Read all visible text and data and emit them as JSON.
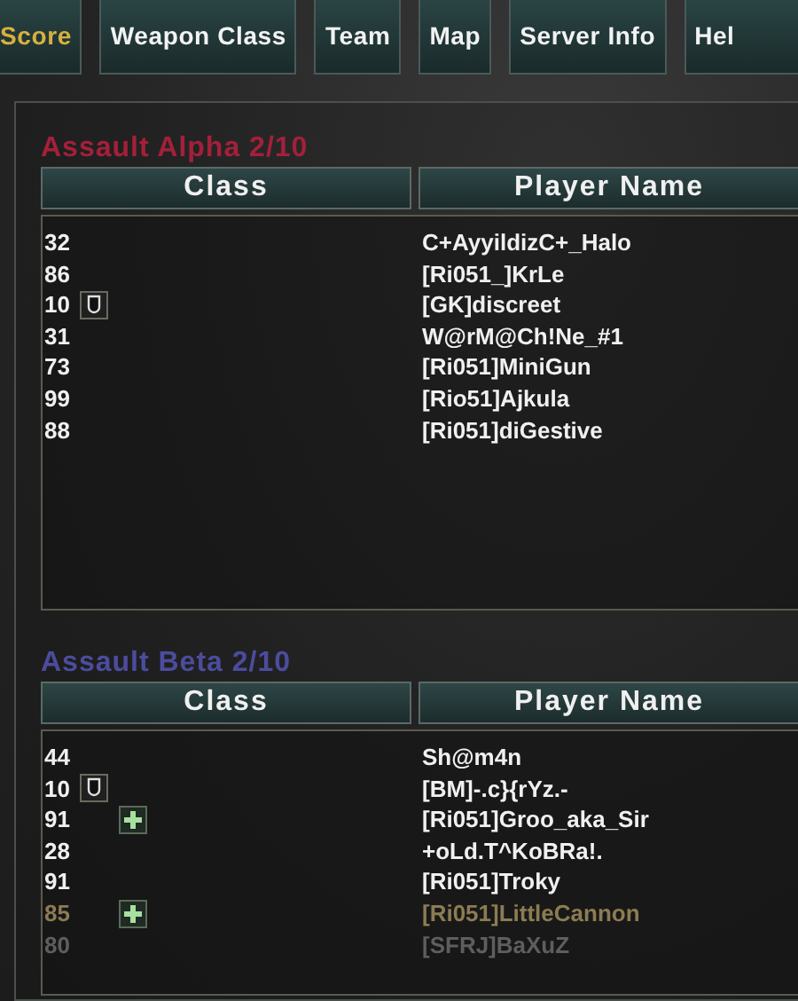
{
  "tabs": [
    {
      "label": "Score",
      "selected": true
    },
    {
      "label": "Weapon Class",
      "selected": false
    },
    {
      "label": "Team",
      "selected": false
    },
    {
      "label": "Map",
      "selected": false
    },
    {
      "label": "Server Info",
      "selected": false
    },
    {
      "label": "Hel",
      "selected": false
    }
  ],
  "teams": [
    {
      "title": "Assault Alpha 2/10",
      "color": "#a3203a",
      "columns": [
        "Class",
        "Player Name"
      ],
      "rows": [
        {
          "class": "32",
          "player": "C+AyyildizC+_Halo",
          "kind": "normal"
        },
        {
          "class": "86",
          "player": "[Ri051_]KrLe",
          "kind": "normal"
        },
        {
          "class": "10",
          "badge": {
            "kind": "shield"
          },
          "player": "[GK]discreet",
          "kind": "normal"
        },
        {
          "class": "31",
          "player": "W@rM@Ch!Ne_#1",
          "kind": "normal"
        },
        {
          "class": "73",
          "player": "[Ri051]MiniGun",
          "kind": "normal"
        },
        {
          "class": "99",
          "player": "[Rio51]Ajkula",
          "kind": "normal"
        },
        {
          "class": "88",
          "player": "[Ri051]diGestive",
          "kind": "normal"
        }
      ]
    },
    {
      "title": "Assault Beta 2/10",
      "color": "#4c4c9e",
      "columns": [
        "Class",
        "Player Name"
      ],
      "rows": [
        {
          "class": "44",
          "player": "Sh@m4n",
          "kind": "normal"
        },
        {
          "class": "10",
          "badge": {
            "kind": "shield"
          },
          "player": "[BM]-.c}{rYz.-",
          "kind": "normal"
        },
        {
          "class": "91",
          "badge": {
            "kind": "medic"
          },
          "player": "[Ri051]Groo_aka_Sir",
          "kind": "normal"
        },
        {
          "class": "28",
          "player": "+oLd.T^KoBRa!.",
          "kind": "normal"
        },
        {
          "class": "91",
          "player": "[Ri051]Troky",
          "kind": "normal"
        },
        {
          "class": "85",
          "badge": {
            "kind": "medic"
          },
          "player": "[Ri051]LittleCannon",
          "kind": "self"
        },
        {
          "class": "80",
          "player": "[SFRJ]BaXuZ",
          "kind": "dead"
        }
      ]
    }
  ]
}
